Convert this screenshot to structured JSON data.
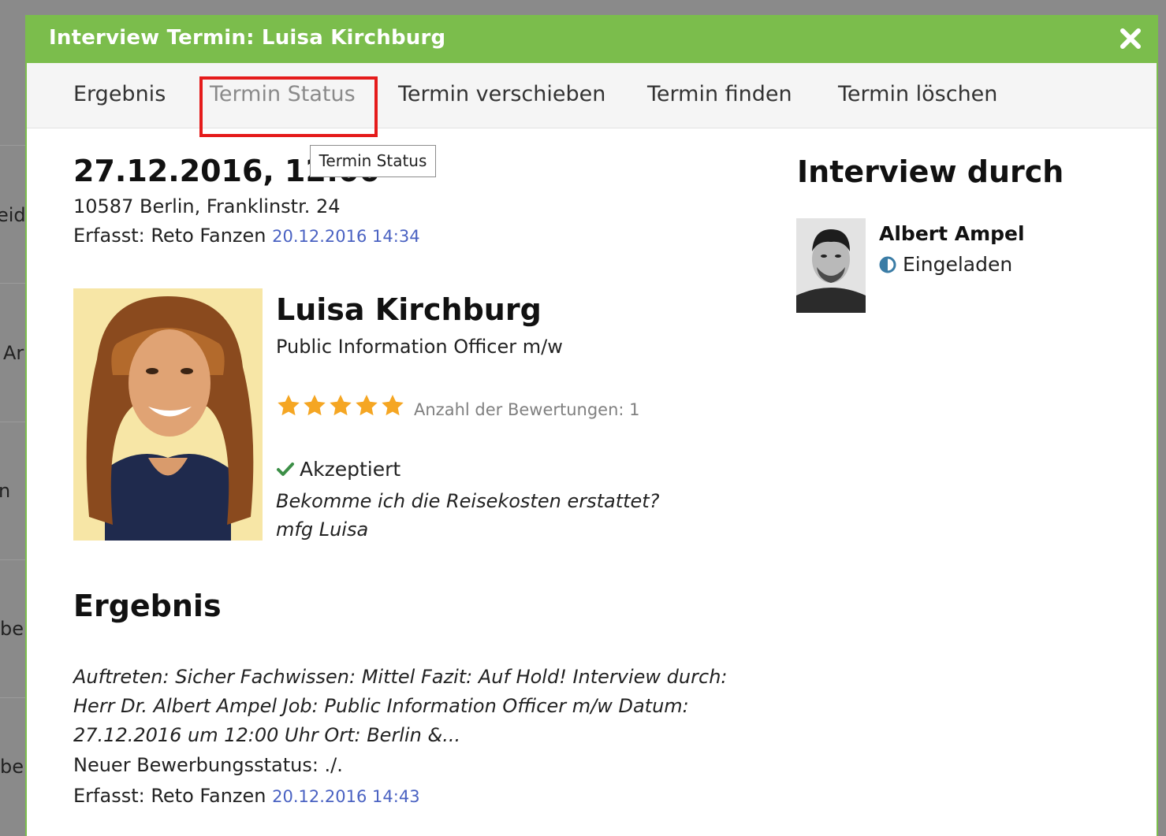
{
  "background": {
    "fragments": [
      "eid",
      "Ar",
      "n",
      "be",
      "be"
    ]
  },
  "modal": {
    "title": "Interview Termin: Luisa Kirchburg",
    "close_icon": "close-icon"
  },
  "tabs": [
    {
      "label": "Ergebnis",
      "active": false
    },
    {
      "label": "Termin Status",
      "active": true
    },
    {
      "label": "Termin verschieben",
      "active": false
    },
    {
      "label": "Termin finden",
      "active": false
    },
    {
      "label": "Termin löschen",
      "active": false
    }
  ],
  "tooltip": "Termin Status",
  "appointment": {
    "datetime": "27.12.2016, 12:00",
    "location": "10587 Berlin, Franklinstr. 24",
    "captured_label": "Erfasst: Reto Fanzen",
    "captured_time": "20.12.2016 14:34"
  },
  "candidate": {
    "name": "Luisa Kirchburg",
    "job": "Public Information Officer m/w",
    "rating": 5,
    "rating_max": 5,
    "rating_count_label": "Anzahl der Bewertungen: 1",
    "status": "Akzeptiert",
    "comment": "Bekomme ich die Reisekosten erstattet? mfg Luisa"
  },
  "result": {
    "title": "Ergebnis",
    "text": "Auftreten: Sicher Fachwissen: Mittel Fazit: Auf Hold! Interview durch: Herr Dr. Albert Ampel Job: Public Information Officer m/w Datum: 27.12.2016 um 12:00 Uhr Ort: Berlin &...",
    "new_status": "Neuer Bewerbungsstatus: ./.",
    "captured_label": "Erfasst: Reto Fanzen",
    "captured_time": "20.12.2016 14:43"
  },
  "interviewer": {
    "title": "Interview durch",
    "name": "Albert Ampel",
    "status": "Eingeladen",
    "status_icon": "half-circle-icon"
  },
  "colors": {
    "header": "#7bbd4c",
    "highlight": "#e51b1b",
    "star": "#f5a623",
    "link": "#4a62c2",
    "check": "#3c8f47",
    "status_icon": "#3a7ca5"
  }
}
